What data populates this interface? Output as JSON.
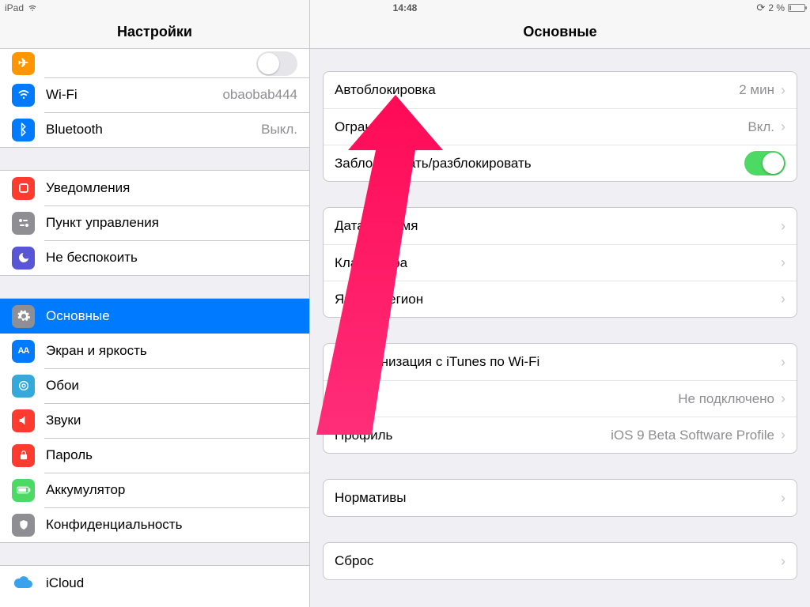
{
  "statusbar": {
    "device": "iPad",
    "time": "14:48",
    "battery_text": "2 %"
  },
  "sidebar": {
    "title": "Настройки",
    "airplane": {
      "label": "Авиарежим",
      "on": false
    },
    "wifi": {
      "label": "Wi-Fi",
      "value": "obaobab444"
    },
    "bluetooth": {
      "label": "Bluetooth",
      "value": "Выкл."
    },
    "notifications": {
      "label": "Уведомления"
    },
    "control_center": {
      "label": "Пункт управления"
    },
    "dnd": {
      "label": "Не беспокоить"
    },
    "general": {
      "label": "Основные"
    },
    "display": {
      "label": "Экран и яркость"
    },
    "wallpaper": {
      "label": "Обои"
    },
    "sounds": {
      "label": "Звуки"
    },
    "passcode": {
      "label": "Пароль"
    },
    "battery": {
      "label": "Аккумулятор"
    },
    "privacy": {
      "label": "Конфиденциальность"
    },
    "icloud": {
      "label": "iCloud"
    }
  },
  "detail": {
    "title": "Основные",
    "group1": {
      "autolock": {
        "label": "Автоблокировка",
        "value": "2 мин"
      },
      "restrictions": {
        "label": "Ограничения",
        "value": "Вкл."
      },
      "lockunlock": {
        "label": "Заблокировать/разблокировать"
      }
    },
    "group2": {
      "datetime": {
        "label": "Дата и время"
      },
      "keyboard": {
        "label": "Клавиатура"
      },
      "language": {
        "label": "Язык и регион"
      }
    },
    "group3": {
      "itunes_wifi": {
        "label": "Синхронизация с iTunes по Wi-Fi"
      },
      "vpn": {
        "label": "VPN",
        "value": "Не подключено"
      },
      "profile": {
        "label": "Профиль",
        "value": "iOS 9 Beta Software Profile"
      }
    },
    "group4": {
      "regulatory": {
        "label": "Нормативы"
      }
    },
    "group5": {
      "reset": {
        "label": "Сброс"
      }
    }
  }
}
